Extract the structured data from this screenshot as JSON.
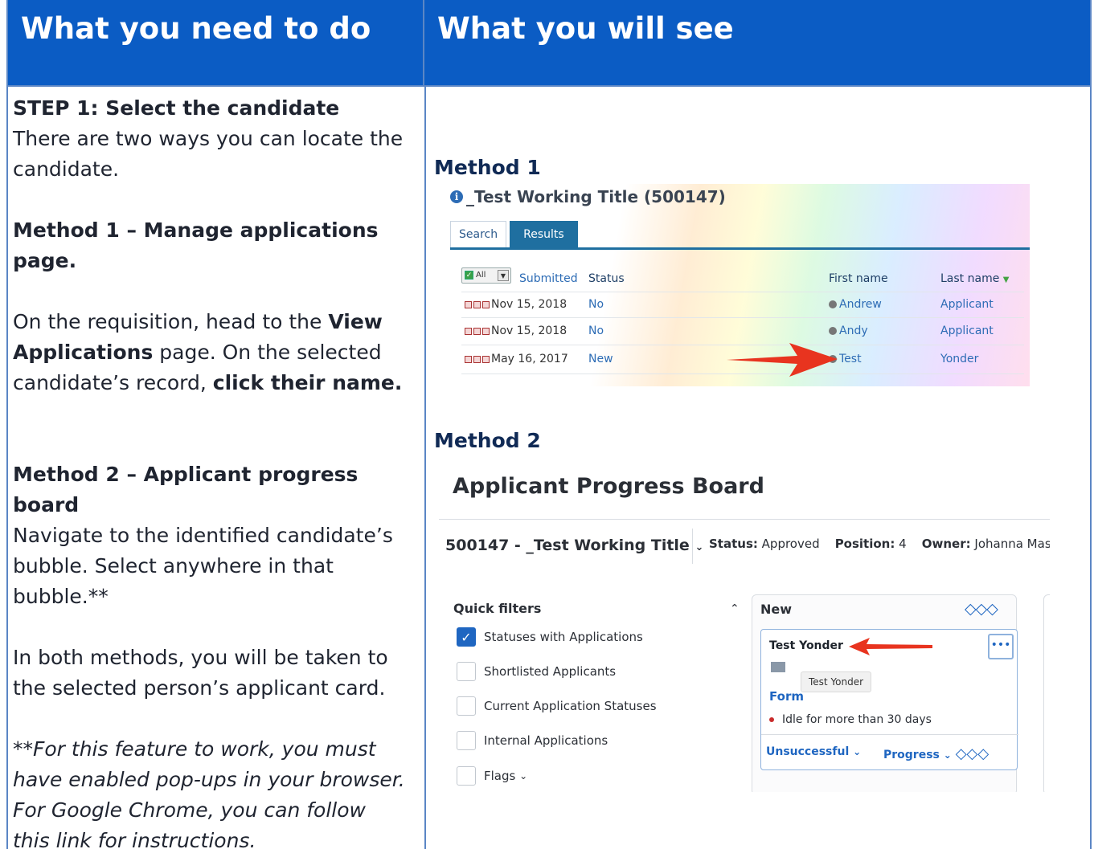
{
  "headers": {
    "left": "What you need to do",
    "right": "What you will see"
  },
  "left": {
    "step_title": "STEP 1: Select the candidate",
    "step_text": "There are two ways you can locate the candidate.",
    "method1_title": "Method 1 – Manage applications page.",
    "method1_text_a": "On the requisition, head to the ",
    "method1_text_b": "View Applications",
    "method1_text_c": " page. On the selected candidate’s record, ",
    "method1_text_d": "click their name.",
    "method2_title": "Method 2 – Applicant progress board",
    "method2_text": "Navigate to the identified candidate’s bubble. Select anywhere in that bubble.**",
    "both_methods_text": "In both methods, you will be taken to the selected person’s applicant card.",
    "note_a": "**For this feature to work, you must have enabled pop-ups in your browser. For Google Chrome, you can follow ",
    "note_link": "this link",
    "note_b": " for instructions."
  },
  "right": {
    "method1_label": "Method 1",
    "method2_label": "Method 2"
  },
  "shot1": {
    "title": "_Test Working Title (500147)",
    "tabs": [
      "Search",
      "Results"
    ],
    "all_label": "All",
    "columns": [
      "Submitted",
      "Status",
      "First name",
      "Last name"
    ],
    "rows": [
      {
        "date": "Nov 15, 2018",
        "status": "No",
        "first": "Andrew",
        "last": "Applicant"
      },
      {
        "date": "Nov 15, 2018",
        "status": "No",
        "first": "Andy",
        "last": "Applicant"
      },
      {
        "date": "May 16, 2017",
        "status": "New",
        "first": "Test",
        "last": "Yonder"
      }
    ]
  },
  "shot2": {
    "title": "Applicant Progress Board",
    "requisition": "500147 - _Test Working Title",
    "status_label": "Status:",
    "status_value": "Approved",
    "position_label": "Position:",
    "position_value": "4",
    "owner_label": "Owner:",
    "owner_value": "Johanna Masba",
    "quick_filters": "Quick filters",
    "filters": [
      {
        "label": "Statuses with Applications",
        "checked": true
      },
      {
        "label": "Shortlisted Applicants",
        "checked": false
      },
      {
        "label": "Current Application Statuses",
        "checked": false
      },
      {
        "label": "Internal Applications",
        "checked": false
      },
      {
        "label": "Flags",
        "checked": false
      }
    ],
    "column_title": "New",
    "card": {
      "name": "Test Yonder",
      "tooltip": "Test Yonder",
      "form": "Form",
      "idle": "Idle for more than 30 days",
      "unsuccessful": "Unsuccessful",
      "progress": "Progress"
    }
  },
  "colors": {
    "header_bg": "#0b5cc4",
    "border": "#5b86c5",
    "link_blue": "#2d6cb5",
    "arrow_red": "#e8341f"
  }
}
